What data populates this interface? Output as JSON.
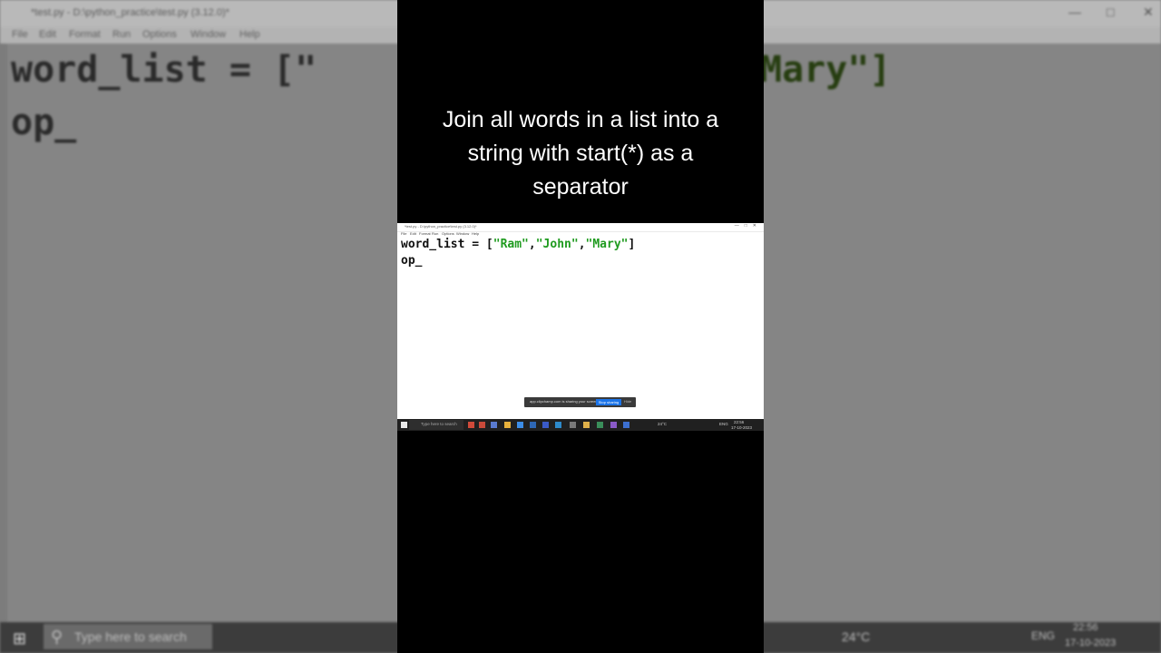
{
  "background": {
    "window_title": "*test.py - D:\\python_practice\\test.py (3.12.0)*",
    "menu": [
      "File",
      "Edit",
      "Format",
      "Run",
      "Options",
      "Window",
      "Help"
    ],
    "code_line1_prefix": "word_list = [\"",
    "code_line1_suffix": "Mary\"]",
    "code_line2": "op_",
    "taskbar": {
      "search_placeholder": "Type here to search",
      "weather": "24°C",
      "language": "ENG",
      "time": "22:56",
      "date": "17-10-2023"
    }
  },
  "caption": "Join all words in a list into a\nstring with start(*) as a\nseparator",
  "editor": {
    "window_title": "*test.py - D:\\python_practice\\test.py (3.12.0)*",
    "menu": [
      "File",
      "Edit",
      "Format",
      "Run",
      "Options",
      "Window",
      "Help"
    ],
    "code": {
      "line1_var": "word_list = [",
      "str_ram": "\"Ram\"",
      "comma1": ",",
      "str_john": "\"John\"",
      "comma2": ",",
      "str_mary": "\"Mary\"",
      "close": "]",
      "line2": "op_"
    },
    "sharing_bar": {
      "text": "app.clipchamp.com is sharing your screen.",
      "stop_label": "Stop sharing",
      "hide_label": "Hide"
    },
    "taskbar": {
      "search_placeholder": "Type here to search",
      "weather": "24°C",
      "language": "ENG",
      "time": "22:56",
      "date": "17-10-2023"
    }
  },
  "colors": {
    "string_literal": "#1f9b1f",
    "panel": "#000000",
    "caption_text": "#ffffff"
  }
}
